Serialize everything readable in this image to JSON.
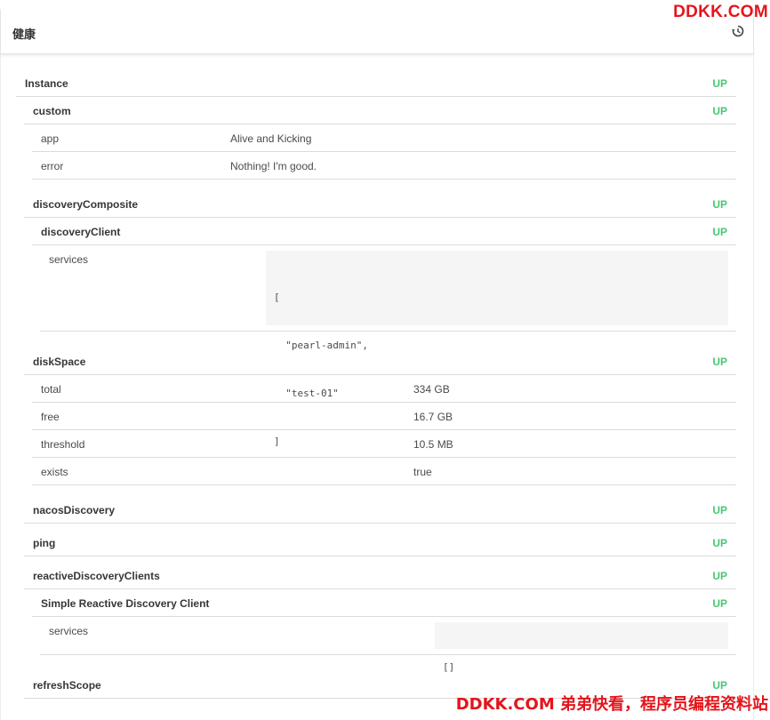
{
  "header": {
    "title": "健康",
    "history_icon": "history-icon"
  },
  "watermark": {
    "top": "DDKK.COM",
    "bottom": "DDKK.COM 弟弟快看，程序员编程资料站"
  },
  "status_color": "#48c774",
  "instance": {
    "name": "Instance",
    "status": "UP"
  },
  "custom": {
    "name": "custom",
    "status": "UP",
    "details": [
      {
        "key": "app",
        "value": "Alive and Kicking"
      },
      {
        "key": "error",
        "value": "Nothing! I'm good."
      }
    ]
  },
  "discoveryComposite": {
    "name": "discoveryComposite",
    "status": "UP",
    "discoveryClient": {
      "name": "discoveryClient",
      "status": "UP",
      "services_key": "services",
      "services_lines": [
        "[",
        "  \"pearl-admin\",",
        "  \"test-01\"",
        "]"
      ]
    }
  },
  "diskSpace": {
    "name": "diskSpace",
    "status": "UP",
    "details": [
      {
        "key": "total",
        "value": "334 GB"
      },
      {
        "key": "free",
        "value": "16.7 GB"
      },
      {
        "key": "threshold",
        "value": "10.5 MB"
      },
      {
        "key": "exists",
        "value": "true"
      }
    ]
  },
  "nacosDiscovery": {
    "name": "nacosDiscovery",
    "status": "UP"
  },
  "ping": {
    "name": "ping",
    "status": "UP"
  },
  "reactiveDiscoveryClients": {
    "name": "reactiveDiscoveryClients",
    "status": "UP",
    "simple": {
      "name": "Simple Reactive Discovery Client",
      "status": "UP",
      "services_key": "services",
      "services_value": "[]"
    }
  },
  "refreshScope": {
    "name": "refreshScope",
    "status": "UP"
  }
}
